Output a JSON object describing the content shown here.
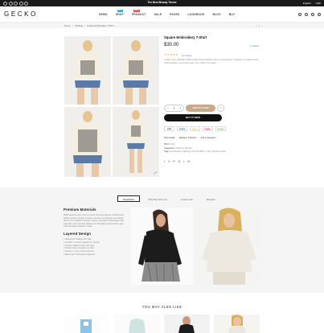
{
  "topbar": {
    "message": "The Best Beauty Theme",
    "language": "English",
    "currency": "USD"
  },
  "header": {
    "logo": "GECKO",
    "nav": [
      {
        "label": "DEMO",
        "badge": ""
      },
      {
        "label": "SHOP",
        "badge": "HOT"
      },
      {
        "label": "PRODUCT",
        "badge": "NEW"
      },
      {
        "label": "SALE",
        "badge": ""
      },
      {
        "label": "PAGES",
        "badge": ""
      },
      {
        "label": "LOOKBOOK",
        "badge": ""
      },
      {
        "label": "BLOG",
        "badge": ""
      },
      {
        "label": "BUY",
        "badge": ""
      }
    ],
    "badge_colors": {
      "hot": "#35a9d8",
      "new": "#e2574c"
    }
  },
  "breadcrumb": [
    "Home",
    "/",
    "Clothing",
    "/",
    "Square Embroidery T-Shirt"
  ],
  "product": {
    "title": "Square Embroidery T-Shirt",
    "price": "$30.00",
    "stock": "In Stock",
    "stars": "★★★★★",
    "reviews": "(1 review)",
    "description": "In ante id ex placerat. Morbi luctus lacus dapibus ante ut consectetur, molestie mi mattis lectus. Cras posuere commodo turpis, nec mollis ut ex ante.",
    "qty": "1",
    "add_to_cart": "ADD TO CART",
    "buy_now": "BUY IT NOW",
    "payments": [
      "VISA",
      "PayPal",
      "Norton",
      "McAfee",
      "Shopify"
    ],
    "links": [
      "Size Guide",
      "Delivery & Return",
      "Ask a Question"
    ],
    "sku_label": "SKU:",
    "sku": "B-AQ",
    "categories_label": "Categories:",
    "categories": "Clothing, Women",
    "tags_label": "Tags:",
    "tags": "Accessories, Clothing, Price $7-$50, T-shirt, Vendor Gecko",
    "share_icons": [
      "f",
      "X",
      "P",
      "G",
      "t",
      "✉"
    ],
    "accent": "#c8a98a"
  },
  "tabs": [
    "Description",
    "Why Buy From Us",
    "Custom tab",
    "Reviews"
  ],
  "description_section": {
    "heading1": "Premium Materials",
    "para": "Mollis pharetra erat. Cras nec tortor vel neque laoreet condimentum. Nullam at lacus semper molestie. Aenean sem pharetra nec magna dictum est. Curabitur vel tellus, tempus sed diam. Pellentesque odio imperdiet. Nunc id lorem facilisis sed. Phasellus semper libero, quis vehicula lacinia, lobortis in dolor.",
    "heading2": "Layered Design",
    "list": [
      "Ullamcorper facilisis nisi, eget",
      "Curabitur orci ante, dapibus at, suscipit",
      "Vivamus dapibus tortor nibh eget",
      "Praesent ante, tincidunt nec felis",
      "Tempus, in nunc sed suscipit nec",
      "Maecenas condimentum ligula vel"
    ]
  },
  "also_like": "YOU MAY ALSO LIKE"
}
